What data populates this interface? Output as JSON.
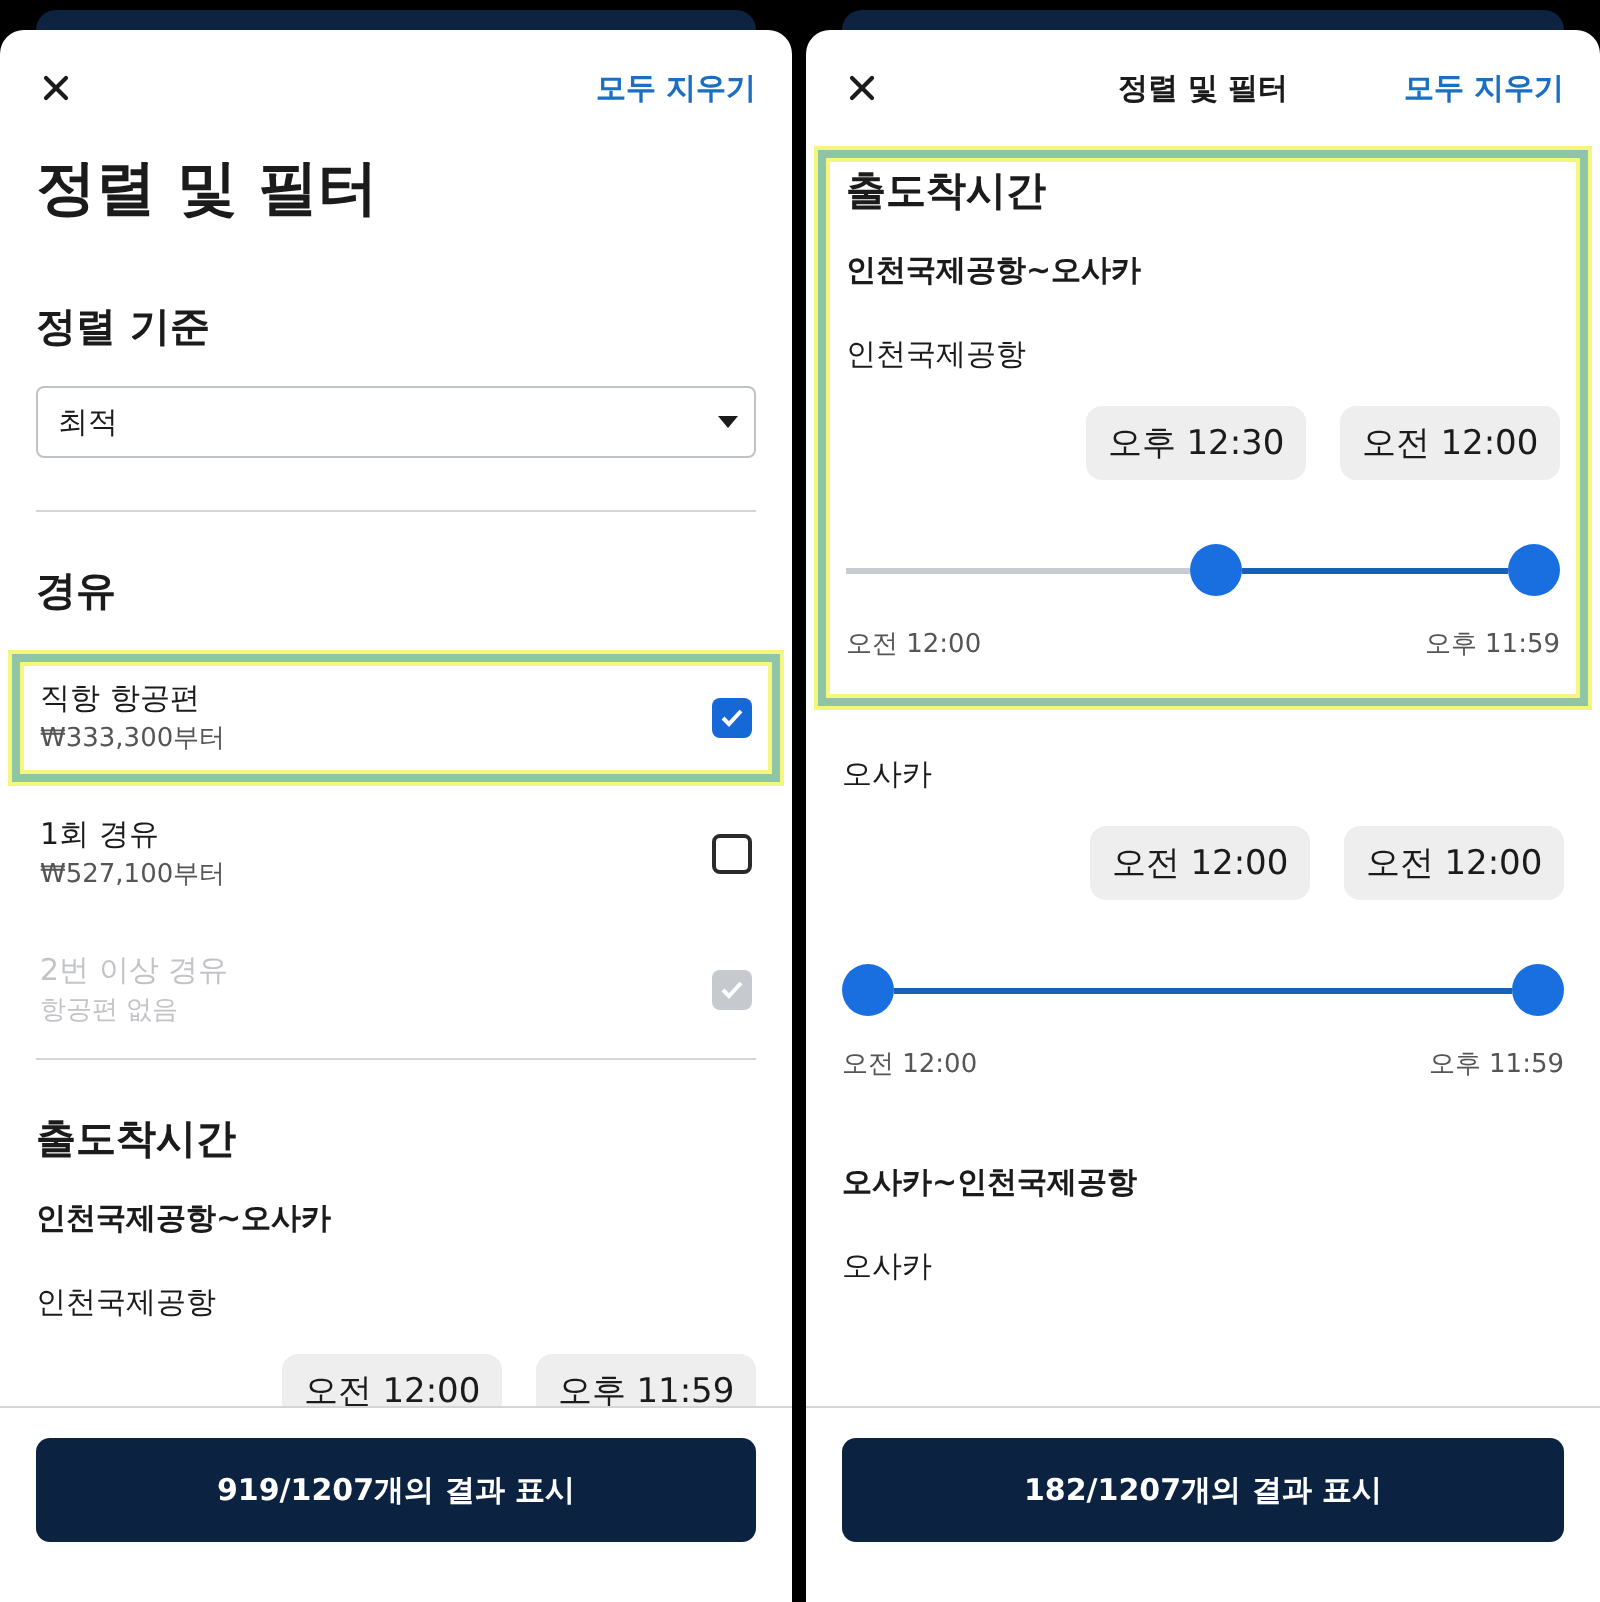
{
  "panels": [
    {
      "header": {
        "clear_all": "모두 지우기"
      },
      "blocks": [
        {
          "kind": "page_title",
          "text": "정렬 및 필터"
        },
        {
          "kind": "heading",
          "text": "정렬 기준"
        },
        {
          "kind": "select",
          "value": "최적"
        },
        {
          "kind": "divider"
        },
        {
          "kind": "heading",
          "text": "경유"
        },
        {
          "kind": "option",
          "label": "직항 항공편",
          "price": "₩333,300부터",
          "checked": true,
          "disabled": false,
          "highlighted": true
        },
        {
          "kind": "option",
          "label": "1회 경유",
          "price": "₩527,100부터",
          "checked": false,
          "disabled": false,
          "highlighted": false
        },
        {
          "kind": "option",
          "label": "2번 이상 경유",
          "price": "항공편 없음",
          "checked": true,
          "disabled": true,
          "highlighted": false
        },
        {
          "kind": "divider"
        },
        {
          "kind": "heading",
          "text": "출도착시간"
        },
        {
          "kind": "route",
          "text": "인천국제공항~오사카"
        },
        {
          "kind": "place",
          "name": "인천국제공항",
          "chips": [
            "오전 12:00",
            "오후 11:59"
          ]
        }
      ],
      "footer": {
        "button": "919/1207개의 결과 표시"
      }
    },
    {
      "header": {
        "title": "정렬 및 필터",
        "clear_all": "모두 지우기"
      },
      "blocks": [
        {
          "kind": "group",
          "highlighted": true,
          "blocks": [
            {
              "kind": "heading",
              "text": "출도착시간"
            },
            {
              "kind": "route",
              "text": "인천국제공항~오사카"
            },
            {
              "kind": "place",
              "name": "인천국제공항",
              "chips": [
                "오후 12:30",
                "오전 12:00"
              ],
              "thumbs": [
                {
                  "level": 0.52
                },
                {
                  "level": 1
                }
              ],
              "range_start": "오전 12:00",
              "range_end": "오후 11:59"
            }
          ]
        },
        {
          "kind": "place",
          "name": "오사카",
          "chips": [
            "오전 12:00",
            "오전 12:00"
          ],
          "thumbs": [
            {
              "level": 0
            },
            {
              "level": 1
            }
          ],
          "range_start": "오전 12:00",
          "range_end": "오후 11:59"
        },
        {
          "kind": "route",
          "text": "오사카~인천국제공항"
        },
        {
          "kind": "place",
          "name": "오사카"
        }
      ],
      "footer": {
        "button": "182/1207개의 결과 표시"
      }
    }
  ]
}
